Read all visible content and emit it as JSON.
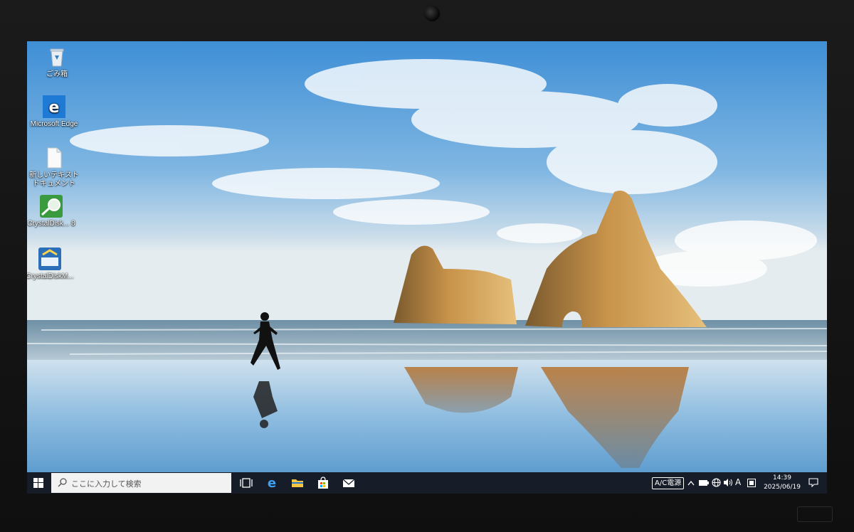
{
  "desktop": {
    "icons": [
      {
        "label": "ごみ箱",
        "icon": "recycle-bin-icon"
      },
      {
        "label": "Microsoft Edge",
        "icon": "edge-icon"
      },
      {
        "label": "新しいテキスト ドキュメント",
        "icon": "text-document-icon"
      },
      {
        "label": "CrystalDisk... 8",
        "icon": "crystaldiskinfo-icon"
      },
      {
        "label": "CrystalDiskM...",
        "icon": "crystaldiskmark-icon"
      }
    ]
  },
  "taskbar": {
    "search_placeholder": "ここに入力して検索",
    "pinned": [
      "task-view-icon",
      "edge-icon",
      "file-explorer-icon",
      "store-icon",
      "mail-icon"
    ],
    "tray": {
      "power_label": "A/C電源",
      "ime_mode": "A",
      "time": "14:39",
      "date": "2025/06/19"
    }
  },
  "colors": {
    "taskbar_bg": "#161c28",
    "sky_top": "#3f8fd6",
    "edge_blue": "#1f7ad6"
  }
}
